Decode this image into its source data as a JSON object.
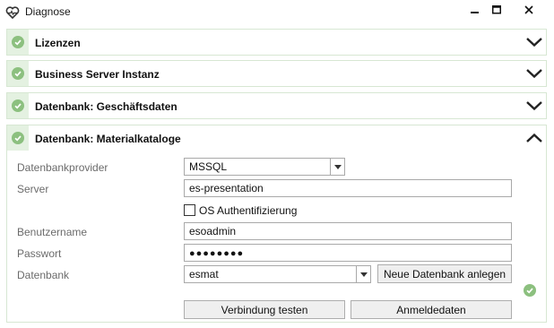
{
  "window": {
    "title": "Diagnose",
    "app_icon": "heart-pulse-icon",
    "controls": [
      "minimize-icon",
      "maximize-icon",
      "close-icon"
    ]
  },
  "sections": [
    {
      "title": "Lizenzen",
      "status": "ok",
      "expanded": false
    },
    {
      "title": "Business Server Instanz",
      "status": "ok",
      "expanded": false
    },
    {
      "title": "Datenbank: Geschäftsdaten",
      "status": "ok",
      "expanded": false
    },
    {
      "title": "Datenbank: Materialkataloge",
      "status": "ok",
      "expanded": true
    }
  ],
  "form": {
    "provider_label": "Datenbankprovider",
    "provider_value": "MSSQL",
    "server_label": "Server",
    "server_value": "es-presentation",
    "os_auth_label": "OS Authentifizierung",
    "os_auth_checked": false,
    "username_label": "Benutzername",
    "username_value": "esoadmin",
    "password_label": "Passwort",
    "password_value": "●●●●●●●●",
    "database_label": "Datenbank",
    "database_value": "esmat",
    "new_db_button": "Neue Datenbank anlegen",
    "test_connection_button": "Verbindung testen",
    "credentials_button": "Anmeldedaten",
    "connection_status": "ok"
  },
  "colors": {
    "check_green": "#8cc07f",
    "section_border": "#d7e7d3",
    "label_gray": "#6b6b6b"
  }
}
